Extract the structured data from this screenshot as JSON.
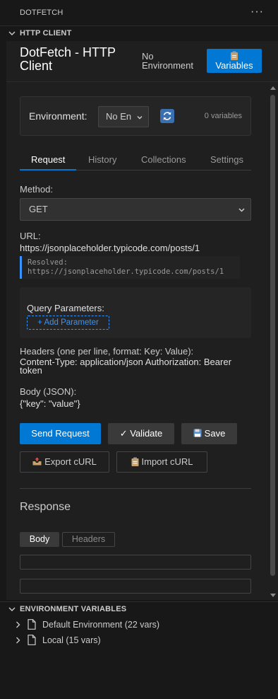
{
  "header": {
    "title": "DOTFETCH",
    "more_icon": "ellipsis-icon",
    "more_glyph": "···"
  },
  "http_section": {
    "label": "HTTP CLIENT",
    "expanded": true
  },
  "app": {
    "title": "DotFetch - HTTP Client",
    "environment_status": "No Environment",
    "variables_button": "Variables",
    "variables_icon": "clipboard-icon"
  },
  "environment": {
    "label": "Environment:",
    "selected": "No En",
    "refresh_icon": "refresh-icon",
    "count": "0 variables"
  },
  "tabs": [
    {
      "label": "Request",
      "active": true
    },
    {
      "label": "History",
      "active": false
    },
    {
      "label": "Collections",
      "active": false
    },
    {
      "label": "Settings",
      "active": false
    }
  ],
  "request": {
    "method_label": "Method:",
    "method": "GET",
    "url_label": "URL:",
    "url": "https://jsonplaceholder.typicode.com/posts/1",
    "resolved_label": "Resolved:",
    "resolved_url": "https://jsonplaceholder.typicode.com/posts/1",
    "query_label": "Query Parameters:",
    "add_param": "+ Add Parameter",
    "headers_label": "Headers (one per line, format: Key: Value):",
    "headers_value": "Content-Type: application/json Authorization: Bearer token",
    "body_label": "Body (JSON):",
    "body_value": "{\"key\": \"value\"}"
  },
  "actions": {
    "send": "Send Request",
    "validate": "✓ Validate",
    "save": "Save",
    "save_icon": "floppy-disk-icon",
    "export": "Export cURL",
    "export_icon": "outbox-tray-icon",
    "import": "Import cURL",
    "import_icon": "clipboard-icon"
  },
  "response": {
    "title": "Response",
    "tabs": [
      {
        "label": "Body",
        "active": true
      },
      {
        "label": "Headers",
        "active": false
      }
    ]
  },
  "env_section": {
    "label": "ENVIRONMENT VARIABLES",
    "expanded": true,
    "items": [
      {
        "label": "Default Environment (22 vars)"
      },
      {
        "label": "Local (15 vars)"
      }
    ]
  },
  "colors": {
    "accent": "#0078d4",
    "link": "#3794ff",
    "background": "#181818",
    "panel": "#1f1f1f"
  }
}
